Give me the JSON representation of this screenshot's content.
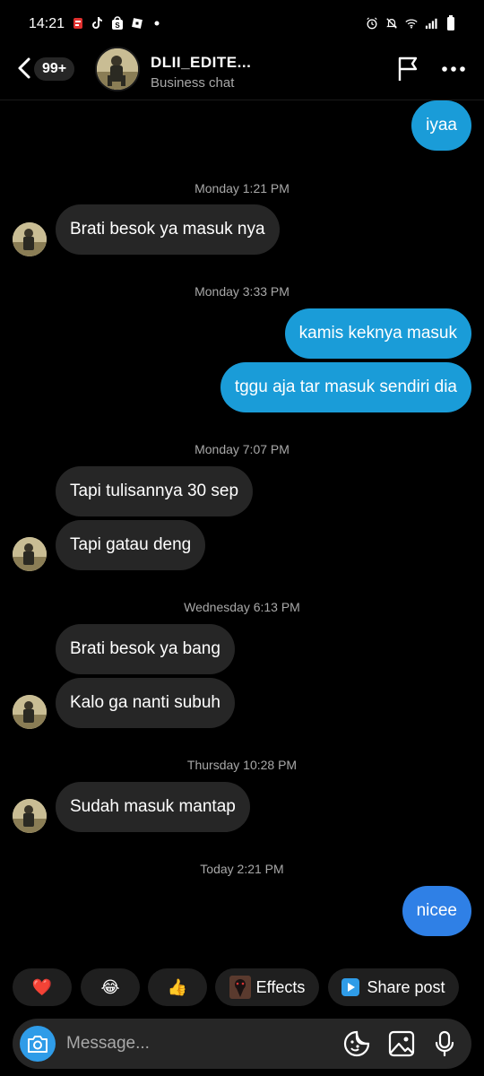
{
  "status_bar": {
    "time": "14:21",
    "left_icons": [
      "notification-app-icon",
      "tiktok-icon",
      "shop-icon",
      "roblox-icon",
      "dot-icon"
    ],
    "right_icons": [
      "alarm-icon",
      "mute-icon",
      "wifi-icon",
      "signal-icon",
      "battery-icon"
    ]
  },
  "header": {
    "badge": "99+",
    "name": "DLII_EDITE...",
    "subtitle": "Business chat"
  },
  "messages": [
    {
      "type": "out",
      "text": "iyaa"
    },
    {
      "type": "timestamp",
      "text": "Monday 1:21 PM"
    },
    {
      "type": "in",
      "text": "Brati besok ya masuk nya"
    },
    {
      "type": "timestamp",
      "text": "Monday 3:33 PM"
    },
    {
      "type": "out",
      "text": "kamis keknya masuk"
    },
    {
      "type": "out",
      "text": "tggu aja tar masuk sendiri dia"
    },
    {
      "type": "timestamp",
      "text": "Monday 7:07 PM"
    },
    {
      "type": "in",
      "text": "Tapi tulisannya 30 sep"
    },
    {
      "type": "in",
      "text": "Tapi gatau deng"
    },
    {
      "type": "timestamp",
      "text": "Wednesday 6:13 PM"
    },
    {
      "type": "in",
      "text": "Brati besok ya bang"
    },
    {
      "type": "in",
      "text": "Kalo ga nanti subuh"
    },
    {
      "type": "timestamp",
      "text": "Thursday 10:28 PM"
    },
    {
      "type": "in",
      "text": "Sudah masuk mantap"
    },
    {
      "type": "timestamp",
      "text": "Today 2:21 PM"
    },
    {
      "type": "out",
      "text": "nicee"
    }
  ],
  "quick_actions": {
    "heart": "❤️",
    "laugh": "😂",
    "thumbs": "👍",
    "effects_label": "Effects",
    "share_label": "Share post"
  },
  "composer": {
    "placeholder": "Message..."
  },
  "colors": {
    "background": "#000000",
    "incoming_bubble": "#262626",
    "outgoing_bubble": "#1a9cd8",
    "outgoing_bubble_last": "#2f80e6",
    "accent": "#2f9ce8",
    "muted_text": "#a8a8a8"
  }
}
